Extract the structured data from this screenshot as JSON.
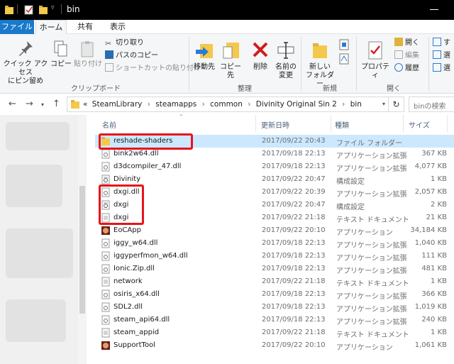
{
  "window": {
    "title": "bin"
  },
  "ribbon_tabs": [
    "ファイル",
    "ホーム",
    "共有",
    "表示"
  ],
  "ribbon": {
    "clipboard": {
      "pin_label_1": "クイック アクセス",
      "pin_label_2": "にピン留め",
      "copy": "コピー",
      "paste": "貼り付け",
      "cut": "切り取り",
      "copy_path": "パスのコピー",
      "paste_shortcut": "ショートカットの貼り付け",
      "group": "クリップボード"
    },
    "organize": {
      "move_to": "移動先",
      "copy_to": "コピー先",
      "delete": "削除",
      "rename_1": "名前の",
      "rename_2": "変更",
      "group": "整理"
    },
    "new": {
      "new_folder_1": "新しい",
      "new_folder_2": "フォルダー",
      "group": "新規"
    },
    "open": {
      "properties": "プロパティ",
      "open": "開く",
      "edit": "編集",
      "history": "履歴",
      "group": "開く"
    },
    "select": {
      "item1": "す",
      "item2": "選",
      "item3": "選"
    }
  },
  "address": {
    "prefix": "«",
    "crumbs": [
      "SteamLibrary",
      "steamapps",
      "common",
      "Divinity Original Sin 2",
      "bin"
    ],
    "search_placeholder": "binの検索"
  },
  "columns": {
    "name": "名前",
    "date": "更新日時",
    "type": "種類",
    "size": "サイズ"
  },
  "files": [
    {
      "name": "reshade-shaders",
      "date": "2017/09/22 20:43",
      "type": "ファイル フォルダー",
      "size": "",
      "icon": "folder-icon",
      "selected": true
    },
    {
      "name": "bink2w64.dll",
      "date": "2017/09/18 22:13",
      "type": "アプリケーション拡張",
      "size": "367 KB",
      "icon": "dll-icon"
    },
    {
      "name": "d3dcompiler_47.dll",
      "date": "2017/09/18 22:13",
      "type": "アプリケーション拡張",
      "size": "4,077 KB",
      "icon": "dll-icon"
    },
    {
      "name": "Divinity",
      "date": "2017/09/22 20:47",
      "type": "構成設定",
      "size": "1 KB",
      "icon": "config-icon"
    },
    {
      "name": "dxgi.dll",
      "date": "2017/09/22 20:39",
      "type": "アプリケーション拡張",
      "size": "2,057 KB",
      "icon": "dll-icon"
    },
    {
      "name": "dxgi",
      "date": "2017/09/22 20:47",
      "type": "構成設定",
      "size": "2 KB",
      "icon": "config-icon"
    },
    {
      "name": "dxgi",
      "date": "2017/09/22 21:18",
      "type": "テキスト ドキュメント",
      "size": "21 KB",
      "icon": "text-icon"
    },
    {
      "name": "EoCApp",
      "date": "2017/09/22 20:10",
      "type": "アプリケーション",
      "size": "34,184 KB",
      "icon": "app-icon"
    },
    {
      "name": "iggy_w64.dll",
      "date": "2017/09/18 22:13",
      "type": "アプリケーション拡張",
      "size": "1,040 KB",
      "icon": "dll-icon"
    },
    {
      "name": "iggyperfmon_w64.dll",
      "date": "2017/09/18 22:13",
      "type": "アプリケーション拡張",
      "size": "111 KB",
      "icon": "dll-icon"
    },
    {
      "name": "Ionic.Zip.dll",
      "date": "2017/09/18 22:13",
      "type": "アプリケーション拡張",
      "size": "481 KB",
      "icon": "dll-icon"
    },
    {
      "name": "network",
      "date": "2017/09/22 21:18",
      "type": "テキスト ドキュメント",
      "size": "1 KB",
      "icon": "text-icon"
    },
    {
      "name": "osiris_x64.dll",
      "date": "2017/09/18 22:13",
      "type": "アプリケーション拡張",
      "size": "366 KB",
      "icon": "dll-icon"
    },
    {
      "name": "SDL2.dll",
      "date": "2017/09/18 22:13",
      "type": "アプリケーション拡張",
      "size": "1,019 KB",
      "icon": "dll-icon"
    },
    {
      "name": "steam_api64.dll",
      "date": "2017/09/18 22:13",
      "type": "アプリケーション拡張",
      "size": "240 KB",
      "icon": "dll-icon"
    },
    {
      "name": "steam_appid",
      "date": "2017/09/22 21:18",
      "type": "テキスト ドキュメント",
      "size": "1 KB",
      "icon": "text-icon"
    },
    {
      "name": "SupportTool",
      "date": "2017/09/22 20:10",
      "type": "アプリケーション",
      "size": "1,061 KB",
      "icon": "app-icon"
    }
  ],
  "colors": {
    "accent": "#1979ca",
    "selection": "#cce8ff",
    "highlight": "#e8141b"
  }
}
